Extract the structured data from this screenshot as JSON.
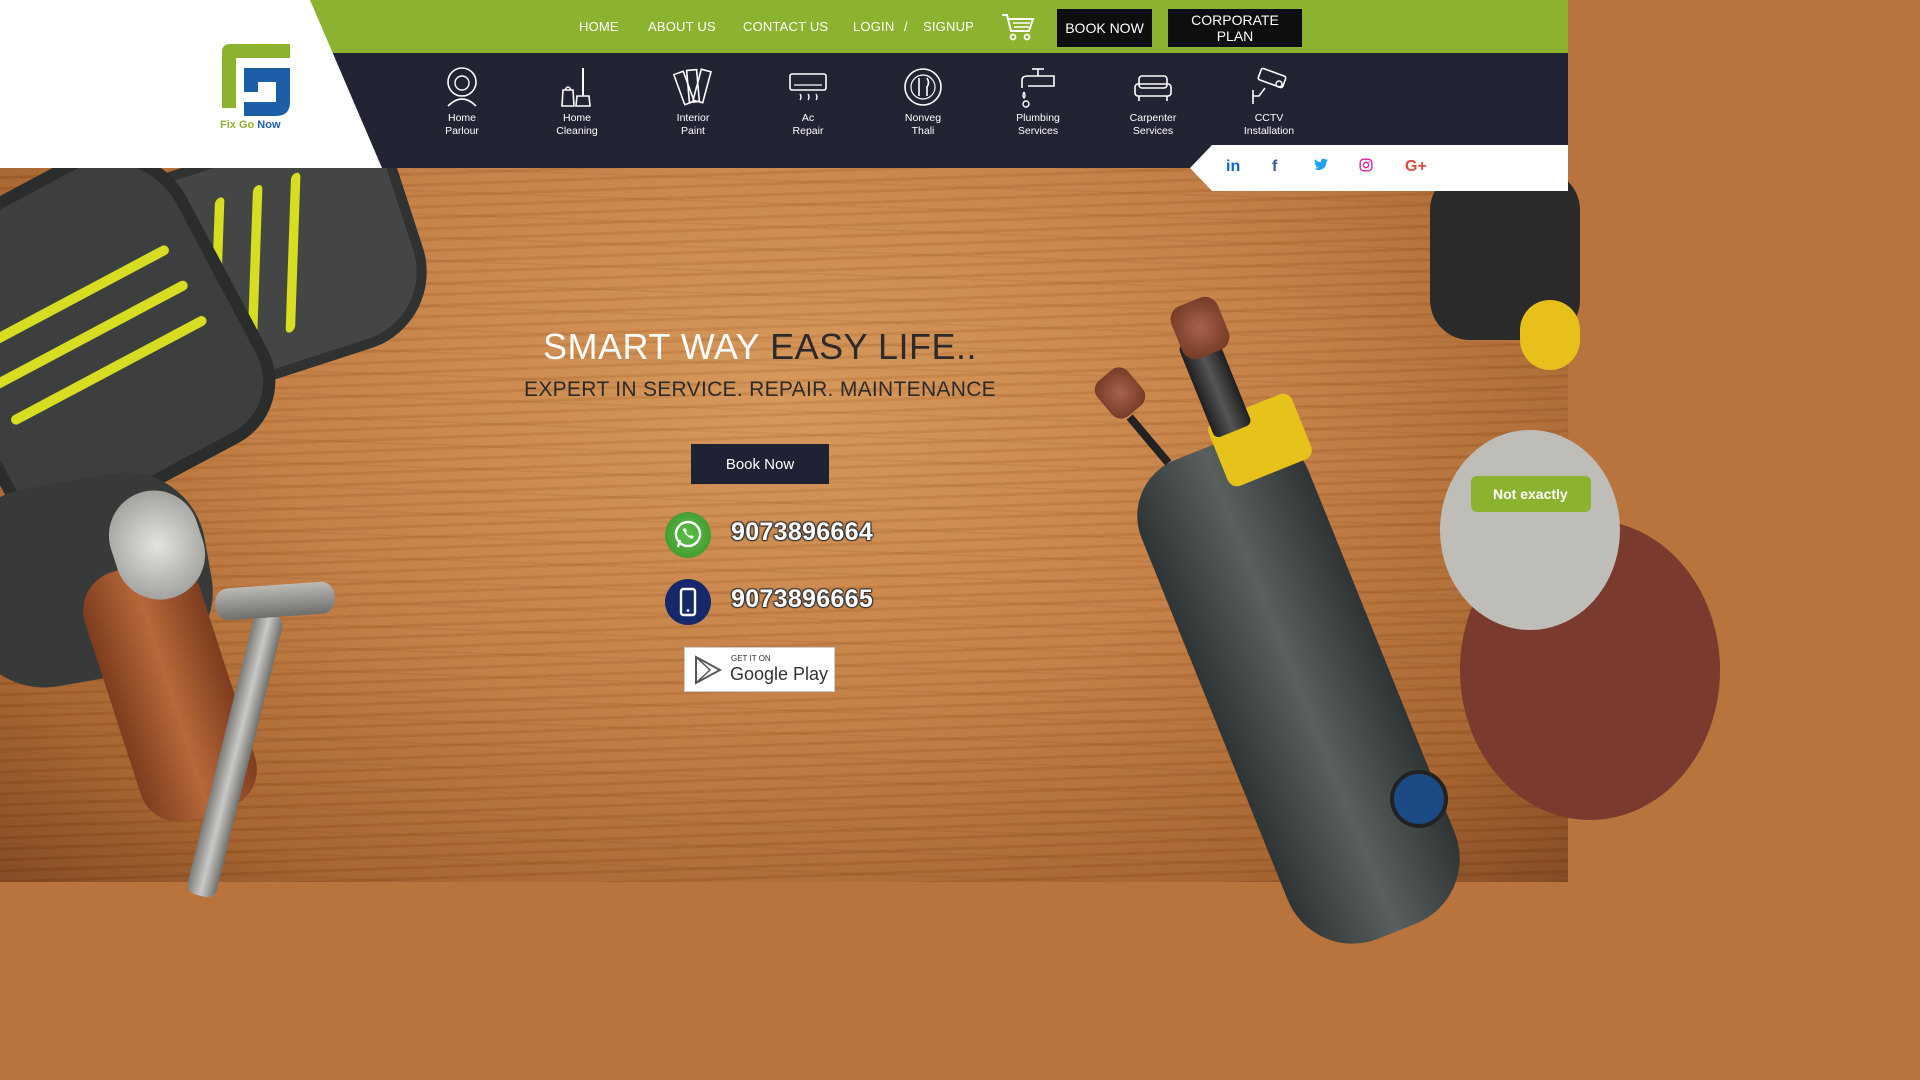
{
  "brand": {
    "name_part1": "Fix Go",
    "name_part2": "Now",
    "colors": {
      "green": "#8cb32f",
      "navy": "#222433",
      "logo_blue": "#1c5fa8"
    }
  },
  "topnav": {
    "home": "HOME",
    "about": "ABOUT US",
    "contact": "CONTACT US",
    "login": "LOGIN",
    "separator": "/",
    "signup": "SIGNUP",
    "cart_icon": "cart-icon",
    "book_now": "BOOK NOW",
    "corporate_plan": "CORPORATE PLAN"
  },
  "services": [
    {
      "line1": "Home",
      "line2": "Parlour",
      "icon": "woman-icon"
    },
    {
      "line1": "Home",
      "line2": "Cleaning",
      "icon": "cleaning-icon"
    },
    {
      "line1": "Interior",
      "line2": "Paint",
      "icon": "paint-swatch-icon"
    },
    {
      "line1": "Ac",
      "line2": "Repair",
      "icon": "air-conditioner-icon"
    },
    {
      "line1": "Nonveg",
      "line2": "Thali",
      "icon": "plate-cutlery-icon"
    },
    {
      "line1": "Plumbing",
      "line2": "Services",
      "icon": "faucet-icon"
    },
    {
      "line1": "Carpenter",
      "line2": "Services",
      "icon": "sofa-icon"
    },
    {
      "line1": "CCTV",
      "line2": "Installation",
      "icon": "cctv-camera-icon"
    }
  ],
  "social": {
    "linkedin": "in",
    "facebook": "f",
    "twitter": "t",
    "instagram": "◎",
    "googleplus": "G+",
    "colors": {
      "linkedin": "#0b66c2",
      "facebook": "#3b5998",
      "twitter": "#1da1f2",
      "instagram": "#d6249f",
      "googleplus": "#dd4b39"
    }
  },
  "hero": {
    "title_white": "SMART WAY",
    "title_dark": "EASY LIFE..",
    "subtitle": "EXPERT IN SERVICE. REPAIR. MAINTENANCE",
    "book_button": "Book Now",
    "whatsapp_number": "9073896664",
    "phone_number": "9073896665",
    "play_small": "GET IT ON",
    "play_big": "Google Play"
  },
  "feedback_tab": "Not exactly"
}
